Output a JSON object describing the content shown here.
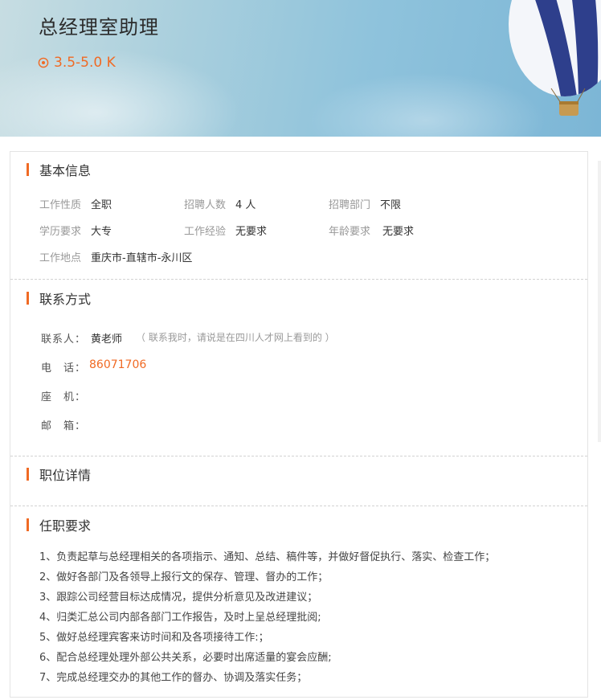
{
  "header": {
    "title": "总经理室助理",
    "salary": "3.5-5.0 K",
    "colors": {
      "accent": "#f06a24"
    }
  },
  "basic_info": {
    "section_title": "基本信息",
    "rows": [
      [
        {
          "label": "工作性质",
          "value": "全职"
        },
        {
          "label": "招聘人数",
          "value": "4 人"
        },
        {
          "label": "招聘部门",
          "value": "不限"
        }
      ],
      [
        {
          "label": "学历要求",
          "value": "大专"
        },
        {
          "label": "工作经验",
          "value": "无要求"
        },
        {
          "label": "年龄要求",
          "value": "无要求"
        }
      ],
      [
        {
          "label": "工作地点",
          "value": "重庆市-直辖市-永川区"
        }
      ]
    ]
  },
  "contact": {
    "section_title": "联系方式",
    "contact_label": "联系人：",
    "contact_value": "黄老师",
    "contact_note": "（ 联系我时，请说是在四川人才网上看到的 ）",
    "phone_label": "电　话：",
    "phone_value": "86071706",
    "landline_label": "座　机：",
    "email_label": "邮　箱："
  },
  "details": {
    "section_title": "职位详情"
  },
  "requirements": {
    "section_title": "任职要求",
    "items": [
      "1、负责起草与总经理相关的各项指示、通知、总结、稿件等，并做好督促执行、落实、检查工作；",
      "2、做好各部门及各领导上报行文的保存、管理、督办的工作；",
      "3、跟踪公司经营目标达成情况，提供分析意见及改进建议；",
      "4、归类汇总公司内部各部门工作报告，及时上呈总经理批阅;",
      "5、做好总经理宾客来访时间和及各项接待工作:；",
      "6、配合总经理处理外部公共关系，必要时出席适量的宴会应酬;",
      "7、完成总经理交办的其他工作的督办、协调及落实任务；"
    ]
  }
}
